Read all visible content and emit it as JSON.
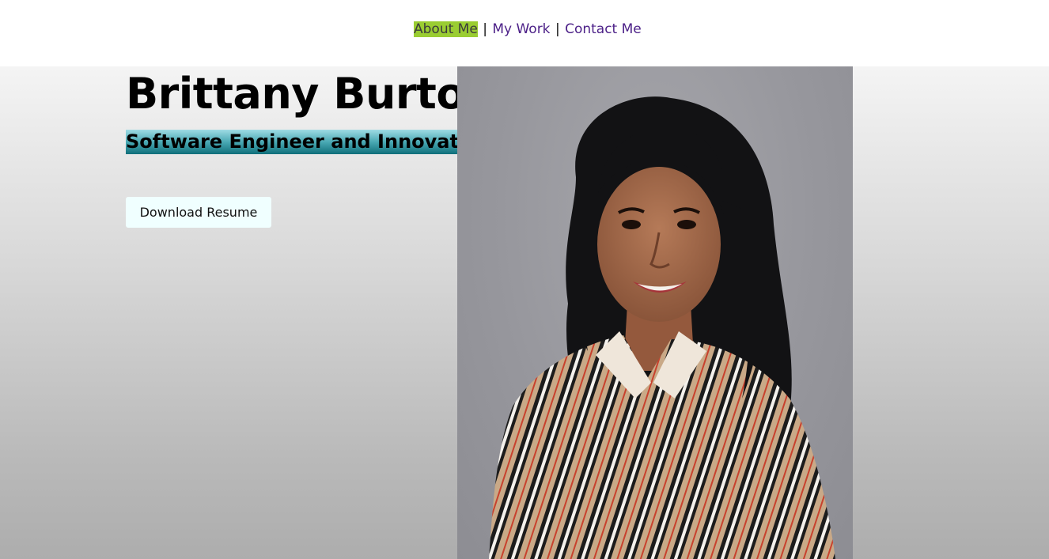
{
  "nav": {
    "items": [
      {
        "label": "About Me",
        "active": true
      },
      {
        "label": "My Work",
        "active": false
      },
      {
        "label": "Contact Me",
        "active": false
      }
    ],
    "separator": "|"
  },
  "hero": {
    "name": "Brittany Burton",
    "tagline": "Software Engineer and Innovator",
    "resume_button": "Download Resume"
  },
  "colors": {
    "nav_active_bg": "#9acd32",
    "nav_link": "#4b1f87",
    "tagline_gradient_top": "#9fdbe4",
    "tagline_gradient_bottom": "#0f6f7a",
    "button_bg": "#f0ffff"
  },
  "portrait": {
    "subject": "professional-headshot",
    "background": "#97979d"
  }
}
